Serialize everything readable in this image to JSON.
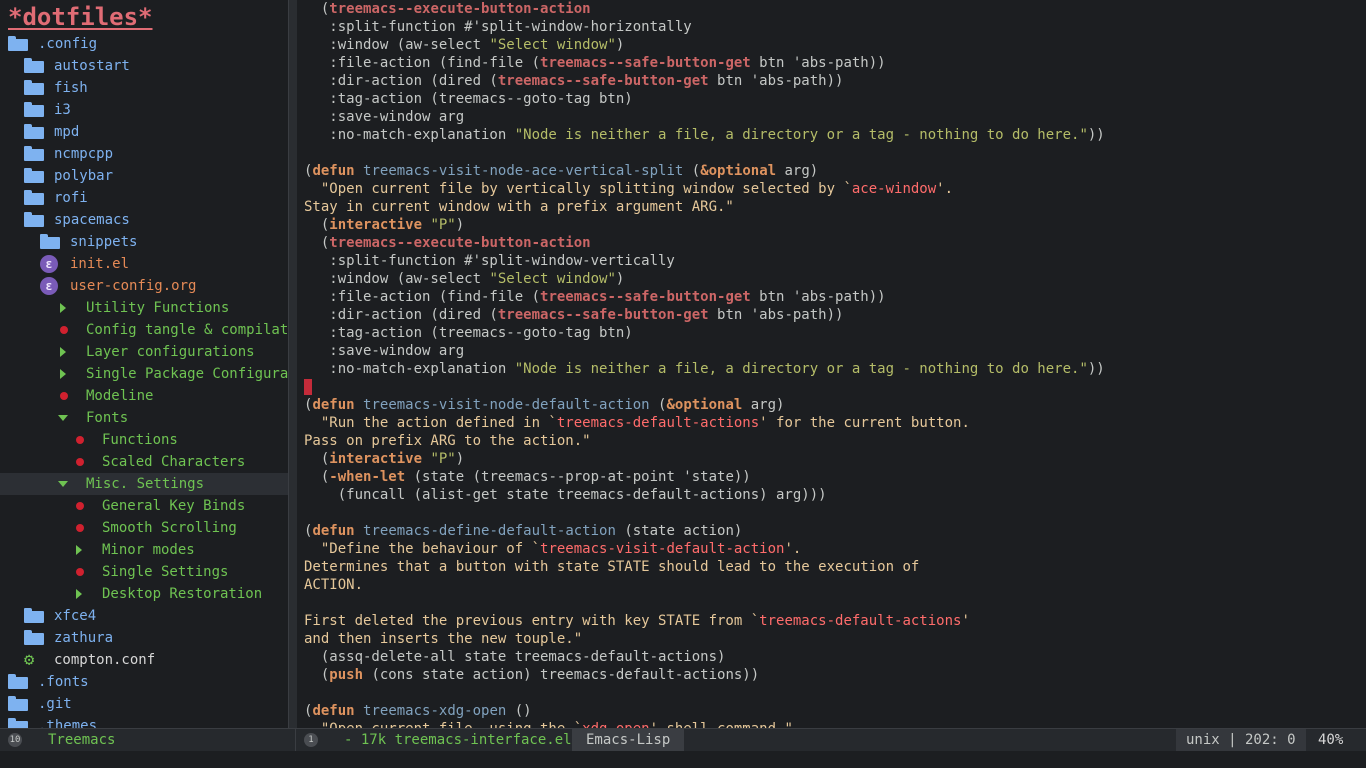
{
  "sidebar": {
    "title": "*dotfiles*",
    "items": [
      {
        "label": ".config",
        "icon": "folder-icon",
        "kind": "folder",
        "depth": 0,
        "color": "#7eb2f0"
      },
      {
        "label": "autostart",
        "icon": "folder-icon",
        "kind": "folder",
        "depth": 1,
        "color": "#7eb2f0"
      },
      {
        "label": "fish",
        "icon": "folder-icon",
        "kind": "folder",
        "depth": 1,
        "color": "#7eb2f0"
      },
      {
        "label": "i3",
        "icon": "folder-icon",
        "kind": "folder",
        "depth": 1,
        "color": "#7eb2f0"
      },
      {
        "label": "mpd",
        "icon": "folder-icon",
        "kind": "folder",
        "depth": 1,
        "color": "#7eb2f0"
      },
      {
        "label": "ncmpcpp",
        "icon": "folder-icon",
        "kind": "folder",
        "depth": 1,
        "color": "#7eb2f0"
      },
      {
        "label": "polybar",
        "icon": "folder-icon",
        "kind": "folder",
        "depth": 1,
        "color": "#7eb2f0"
      },
      {
        "label": "rofi",
        "icon": "folder-icon",
        "kind": "folder",
        "depth": 1,
        "color": "#7eb2f0"
      },
      {
        "label": "spacemacs",
        "icon": "folder-icon",
        "kind": "folder",
        "depth": 1,
        "color": "#7eb2f0"
      },
      {
        "label": "snippets",
        "icon": "folder-icon",
        "kind": "folder",
        "depth": 2,
        "color": "#7eb2f0"
      },
      {
        "label": "init.el",
        "icon": "emacs-lisp-icon",
        "kind": "elisp",
        "depth": 2,
        "color": "#e58a56"
      },
      {
        "label": "user-config.org",
        "icon": "emacs-lisp-icon",
        "kind": "elisp",
        "depth": 2,
        "color": "#e58a56"
      },
      {
        "label": "Utility Functions",
        "icon": "collapsed-arrow-icon",
        "kind": "tri-right",
        "depth": 3,
        "color": "#6fc352"
      },
      {
        "label": "Config tangle & compilation",
        "icon": "leaf-dot-icon",
        "kind": "dot",
        "depth": 3,
        "color": "#6fc352",
        "truncated": true
      },
      {
        "label": "Layer configurations",
        "icon": "collapsed-arrow-icon",
        "kind": "tri-right",
        "depth": 3,
        "color": "#6fc352"
      },
      {
        "label": "Single Package Configuration",
        "icon": "collapsed-arrow-icon",
        "kind": "tri-right",
        "depth": 3,
        "color": "#6fc352",
        "truncated": true
      },
      {
        "label": "Modeline",
        "icon": "leaf-dot-icon",
        "kind": "dot",
        "depth": 3,
        "color": "#6fc352"
      },
      {
        "label": "Fonts",
        "icon": "expanded-arrow-icon",
        "kind": "tri-down",
        "depth": 3,
        "color": "#6fc352"
      },
      {
        "label": "Functions",
        "icon": "leaf-dot-icon",
        "kind": "dot",
        "depth": 4,
        "color": "#6fc352"
      },
      {
        "label": "Scaled Characters",
        "icon": "leaf-dot-icon",
        "kind": "dot",
        "depth": 4,
        "color": "#6fc352"
      },
      {
        "label": "Misc. Settings",
        "icon": "expanded-arrow-icon",
        "kind": "tri-down",
        "depth": 3,
        "color": "#6fc352",
        "selected": true
      },
      {
        "label": "General Key Binds",
        "icon": "leaf-dot-icon",
        "kind": "dot",
        "depth": 4,
        "color": "#6fc352"
      },
      {
        "label": "Smooth Scrolling",
        "icon": "leaf-dot-icon",
        "kind": "dot",
        "depth": 4,
        "color": "#6fc352"
      },
      {
        "label": "Minor modes",
        "icon": "collapsed-arrow-icon",
        "kind": "tri-right",
        "depth": 4,
        "color": "#6fc352"
      },
      {
        "label": "Single Settings",
        "icon": "leaf-dot-icon",
        "kind": "dot",
        "depth": 4,
        "color": "#6fc352"
      },
      {
        "label": "Desktop Restoration",
        "icon": "collapsed-arrow-icon",
        "kind": "tri-right",
        "depth": 4,
        "color": "#6fc352"
      },
      {
        "label": "xfce4",
        "icon": "folder-icon",
        "kind": "folder",
        "depth": 1,
        "color": "#7eb2f0"
      },
      {
        "label": "zathura",
        "icon": "folder-icon",
        "kind": "folder",
        "depth": 1,
        "color": "#7eb2f0"
      },
      {
        "label": "compton.conf",
        "icon": "gear-icon",
        "kind": "gear",
        "depth": 1,
        "color": "#d7d7d7"
      },
      {
        "label": ".fonts",
        "icon": "folder-icon",
        "kind": "folder",
        "depth": 0,
        "color": "#7eb2f0"
      },
      {
        "label": ".git",
        "icon": "folder-icon",
        "kind": "folder",
        "depth": 0,
        "color": "#7eb2f0"
      },
      {
        "label": ".themes",
        "icon": "folder-icon",
        "kind": "folder",
        "depth": 0,
        "color": "#7eb2f0"
      }
    ]
  },
  "editor": {
    "lines": [
      "  (treemacs--execute-button-action",
      "   :split-function #'split-window-horizontally",
      "   :window (aw-select \"Select window\")",
      "   :file-action (find-file (treemacs--safe-button-get btn 'abs-path))",
      "   :dir-action (dired (treemacs--safe-button-get btn 'abs-path))",
      "   :tag-action (treemacs--goto-tag btn)",
      "   :save-window arg",
      "   :no-match-explanation \"Node is neither a file, a directory or a tag - nothing to do here.\"))",
      "",
      "(defun treemacs-visit-node-ace-vertical-split (&optional arg)",
      "  \"Open current file by vertically splitting window selected by `ace-window'.",
      "Stay in current window with a prefix argument ARG.\"",
      "  (interactive \"P\")",
      "  (treemacs--execute-button-action",
      "   :split-function #'split-window-vertically",
      "   :window (aw-select \"Select window\")",
      "   :file-action (find-file (treemacs--safe-button-get btn 'abs-path))",
      "   :dir-action (dired (treemacs--safe-button-get btn 'abs-path))",
      "   :tag-action (treemacs--goto-tag btn)",
      "   :save-window arg",
      "   :no-match-explanation \"Node is neither a file, a directory or a tag - nothing to do here.\"))",
      "",
      "(defun treemacs-visit-node-default-action (&optional arg)",
      "  \"Run the action defined in `treemacs-default-actions' for the current button.",
      "Pass on prefix ARG to the action.\"",
      "  (interactive \"P\")",
      "  (-when-let (state (treemacs--prop-at-point 'state))",
      "    (funcall (alist-get state treemacs-default-actions) arg)))",
      "",
      "(defun treemacs-define-default-action (state action)",
      "  \"Define the behaviour of `treemacs-visit-default-action'.",
      "Determines that a button with state STATE should lead to the execution of",
      "ACTION.",
      "",
      "First deleted the previous entry with key STATE from `treemacs-default-actions'",
      "and then inserts the new touple.\"",
      "  (assq-delete-all state treemacs-default-actions)",
      "  (push (cons state action) treemacs-default-actions))",
      "",
      "(defun treemacs-xdg-open ()",
      "  \"Open current file, using the `xdg-open' shell command.\""
    ]
  },
  "modeline": {
    "left_badge": "10",
    "left_buffer": "Treemacs",
    "right_badge": "1",
    "file_info": "- 17k treemacs-interface.el",
    "major_mode": "Emacs-Lisp",
    "encoding_position": "unix | 202: 0",
    "percent": "40%"
  },
  "colors": {
    "background": "#1c1e21",
    "title": "#e06c75",
    "folder": "#7eb2f0",
    "org_heading": "#6fc352",
    "cursor": "#c42b3a"
  }
}
